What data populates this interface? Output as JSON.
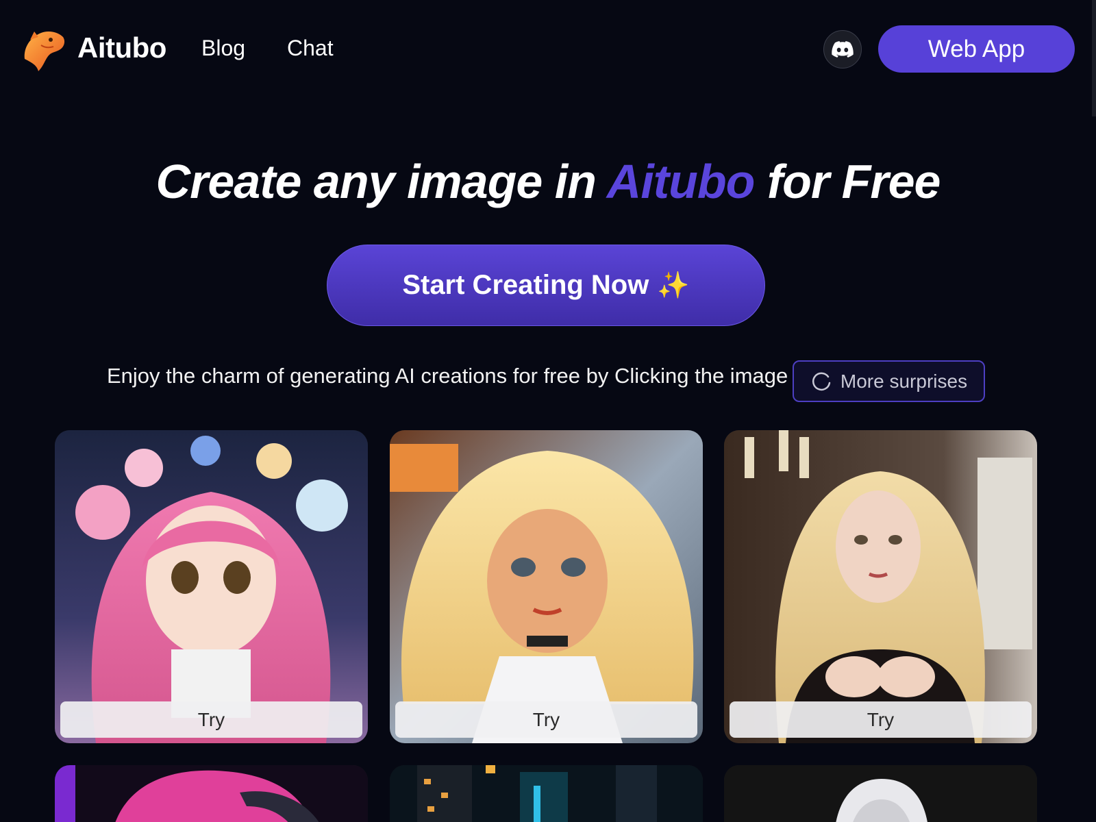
{
  "header": {
    "brand_name": "Aitubo",
    "nav": [
      {
        "label": "Blog"
      },
      {
        "label": "Chat"
      }
    ],
    "discord_icon": "discord-icon",
    "web_app_label": "Web App"
  },
  "hero": {
    "title_part1": "Create any image in ",
    "title_accent": "Aitubo",
    "title_part2": " for Free",
    "accent_color": "#5a45dc",
    "cta_label": "Start Creating Now",
    "cta_icon": "✨",
    "subtitle": "Enjoy the charm of generating AI creations for free by Clicking the image",
    "surprise_label": "More surprises",
    "surprise_icon": "refresh-icon"
  },
  "gallery": {
    "cards": [
      {
        "try_label": "Try",
        "image": "anime girl with pink hair and flower crown"
      },
      {
        "try_label": "Try",
        "image": "blonde stylized girl with freckles"
      },
      {
        "try_label": "Try",
        "image": "blonde woman in black gothic dress"
      },
      {
        "image": "pink hair character with headphones"
      },
      {
        "image": "neon city night scene"
      },
      {
        "image": "white-haired character"
      }
    ]
  },
  "colors": {
    "background": "#060813",
    "primary": "#5741d8",
    "accent_text": "#5a45dc"
  }
}
